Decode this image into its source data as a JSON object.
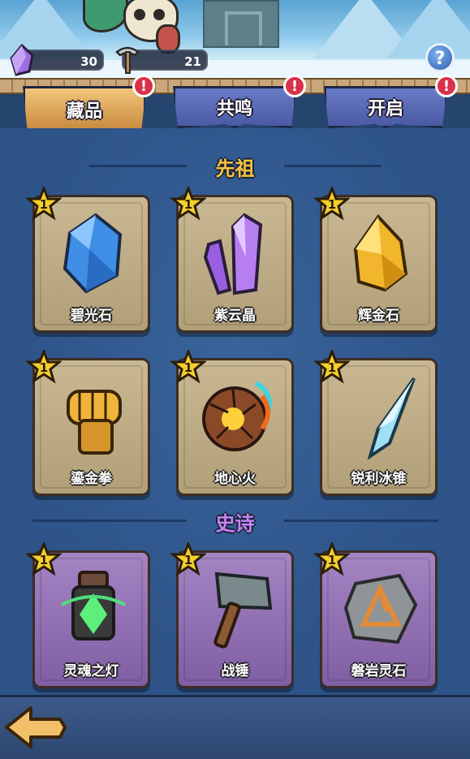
{
  "resources": {
    "crystal_count": "30",
    "ore_count": "21"
  },
  "help_label": "?",
  "tabs": [
    {
      "label": "藏品",
      "active": true,
      "alert": "!"
    },
    {
      "label": "共鸣",
      "active": false,
      "alert": "!"
    },
    {
      "label": "开启",
      "active": false,
      "alert": "!"
    }
  ],
  "sections": [
    {
      "title": "先祖",
      "color": "#f5c242"
    },
    {
      "title": "史诗",
      "color": "#c583f5"
    }
  ],
  "items": [
    {
      "name": "碧光石",
      "level": "1",
      "icon": "blue-crystal-icon",
      "rarity": "ancestor"
    },
    {
      "name": "紫云晶",
      "level": "1",
      "icon": "purple-crystal-icon",
      "rarity": "ancestor"
    },
    {
      "name": "辉金石",
      "level": "1",
      "icon": "gold-ore-icon",
      "rarity": "ancestor"
    },
    {
      "name": "鎏金拳",
      "level": "1",
      "icon": "golden-fist-icon",
      "rarity": "ancestor"
    },
    {
      "name": "地心火",
      "level": "1",
      "icon": "magma-rock-icon",
      "rarity": "ancestor"
    },
    {
      "name": "锐利冰锥",
      "level": "1",
      "icon": "ice-shard-icon",
      "rarity": "ancestor"
    },
    {
      "name": "灵魂之灯",
      "level": "1",
      "icon": "soul-lantern-icon",
      "rarity": "epic"
    },
    {
      "name": "战锤",
      "level": "1",
      "icon": "war-hammer-icon",
      "rarity": "epic"
    },
    {
      "name": "磐岩灵石",
      "level": "1",
      "icon": "rune-stone-icon",
      "rarity": "epic"
    }
  ]
}
